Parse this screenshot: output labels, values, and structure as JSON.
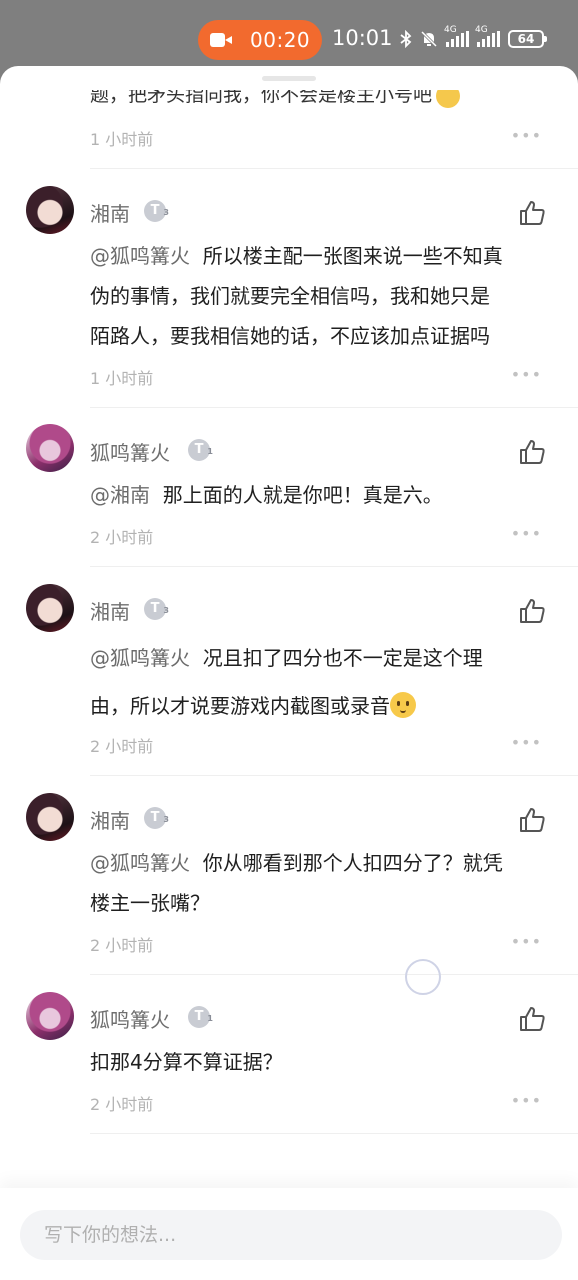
{
  "status_bar": {
    "recording_time": "00:20",
    "clock": "10:01",
    "network_1": "4G",
    "network_2": "4G",
    "battery": "64"
  },
  "partial_comment": {
    "text_fragment": "题，把矛头指向我，你不会是楼主小号吧",
    "time": "1 小时前",
    "more": "•••"
  },
  "comments": [
    {
      "author": "湘南",
      "level": "3",
      "mention": "@狐鸣篝火",
      "text_lines": [
        "所以楼主配一张图来说一些不知真",
        "伪的事情，我们就要完全相信吗，我和她只是",
        "陌路人，要我相信她的话，不应该加点证据吗"
      ],
      "time": "1 小时前",
      "more": "•••"
    },
    {
      "author": "狐鸣篝火",
      "level": "1",
      "mention": "@湘南",
      "text_lines": [
        "那上面的人就是你吧！真是六。"
      ],
      "time": "2 小时前",
      "more": "•••"
    },
    {
      "author": "湘南",
      "level": "3",
      "mention": "@狐鸣篝火",
      "text_lines": [
        "况且扣了四分也不一定是这个理",
        "由，所以才说要游戏内截图或录音"
      ],
      "time": "2 小时前",
      "more": "•••"
    },
    {
      "author": "湘南",
      "level": "3",
      "mention": "@狐鸣篝火",
      "text_lines": [
        "你从哪看到那个人扣四分了？就凭",
        "楼主一张嘴？"
      ],
      "time": "2 小时前",
      "more": "•••"
    },
    {
      "author": "狐鸣篝火",
      "level": "1",
      "mention": "",
      "text_lines": [
        "扣那4分算不算证据？"
      ],
      "time": "2 小时前",
      "more": "•••"
    }
  ],
  "footer": {
    "placeholder": "写下你的想法..."
  },
  "colors": {
    "recording_pill": "#f26a2e",
    "mention": "#6c6c6c",
    "timestamp": "#b3b3b3"
  },
  "icons": [
    "camera-icon",
    "bluetooth-icon",
    "mute-icon",
    "signal-icon",
    "battery-icon",
    "like-icon",
    "more-icon",
    "loading-spinner-icon"
  ]
}
